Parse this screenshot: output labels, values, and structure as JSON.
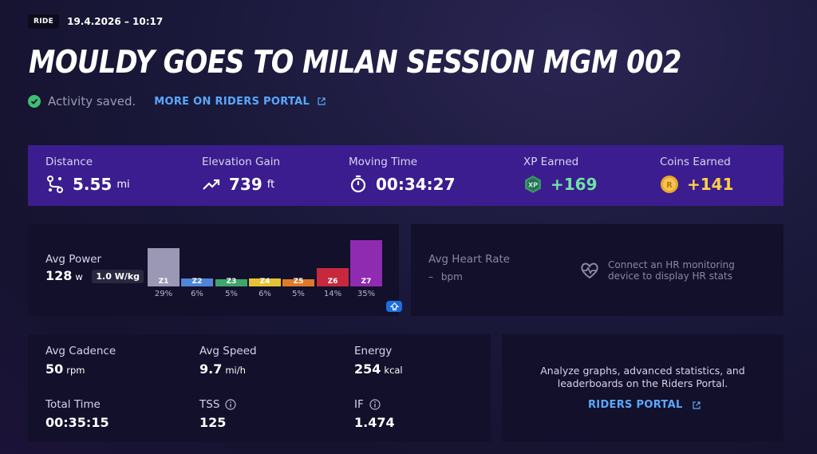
{
  "header": {
    "badge": "RIDE",
    "datetime": "19.4.2026 – 10:17",
    "title": "MOULDY GOES TO MILAN SESSION MGM 002",
    "status": "Activity saved.",
    "portal_link": "MORE ON RIDERS PORTAL"
  },
  "stats": {
    "distance": {
      "label": "Distance",
      "value": "5.55",
      "unit": "mi",
      "icon": "route-icon"
    },
    "elevation": {
      "label": "Elevation Gain",
      "value": "739",
      "unit": "ft",
      "icon": "trend-up-icon"
    },
    "moving_time": {
      "label": "Moving Time",
      "value": "00:34:27",
      "icon": "stopwatch-icon"
    },
    "xp": {
      "label": "XP Earned",
      "value": "+169",
      "icon": "xp-icon",
      "icon_text": "XP"
    },
    "coins": {
      "label": "Coins Earned",
      "value": "+141",
      "icon": "coin-icon",
      "icon_text": "R"
    }
  },
  "power": {
    "label": "Avg Power",
    "value": "128",
    "unit": "w",
    "wkg": "1.0 W/kg",
    "zones": [
      {
        "name": "Z1",
        "percent": "29%",
        "value": 29,
        "color": "#9a98b4"
      },
      {
        "name": "Z2",
        "percent": "6%",
        "value": 6,
        "color": "#4f86d8"
      },
      {
        "name": "Z3",
        "percent": "5%",
        "value": 5,
        "color": "#3ea56b"
      },
      {
        "name": "Z4",
        "percent": "6%",
        "value": 6,
        "color": "#e5c233"
      },
      {
        "name": "Z5",
        "percent": "5%",
        "value": 5,
        "color": "#e07a2a"
      },
      {
        "name": "Z6",
        "percent": "14%",
        "value": 14,
        "color": "#c8283e"
      },
      {
        "name": "Z7",
        "percent": "35%",
        "value": 35,
        "color": "#8e2bb0"
      }
    ]
  },
  "heart_rate": {
    "label": "Avg Heart Rate",
    "value": "–",
    "unit": "bpm",
    "message_line1": "Connect an HR monitoring",
    "message_line2": "device to display HR stats"
  },
  "metrics": {
    "cadence": {
      "label": "Avg Cadence",
      "value": "50",
      "unit": "rpm"
    },
    "speed": {
      "label": "Avg Speed",
      "value": "9.7",
      "unit": "mi/h"
    },
    "energy": {
      "label": "Energy",
      "value": "254",
      "unit": "kcal"
    },
    "total_time": {
      "label": "Total Time",
      "value": "00:35:15"
    },
    "tss": {
      "label": "TSS",
      "value": "125"
    },
    "if": {
      "label": "IF",
      "value": "1.474"
    }
  },
  "portal_panel": {
    "line1": "Analyze graphs, advanced statistics, and",
    "line2": "leaderboards on the Riders Portal.",
    "button": "RIDERS PORTAL"
  }
}
